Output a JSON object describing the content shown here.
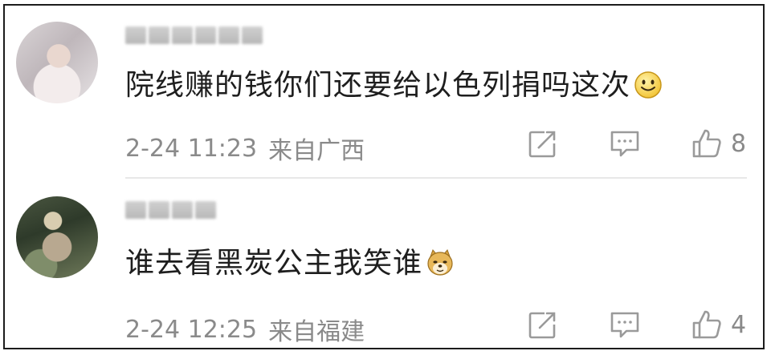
{
  "comments": [
    {
      "text": "院线赚的钱你们还要给以色列捐吗这次",
      "emoji_icon": "smile-emoji-icon",
      "time": "2-24 11:23",
      "location": "来自广西",
      "likes": "8"
    },
    {
      "text": "谁去看黑炭公主我笑谁",
      "emoji_icon": "doge-emoji-icon",
      "time": "2-24 12:25",
      "location": "来自福建",
      "likes": "4"
    }
  ],
  "icons": {
    "share": "share-icon",
    "reply": "comment-icon",
    "like": "thumbs-up-icon"
  },
  "colors": {
    "meta_text": "#8a8a8a",
    "body_text": "#1e1e1e",
    "icon": "#9a9a9a"
  }
}
